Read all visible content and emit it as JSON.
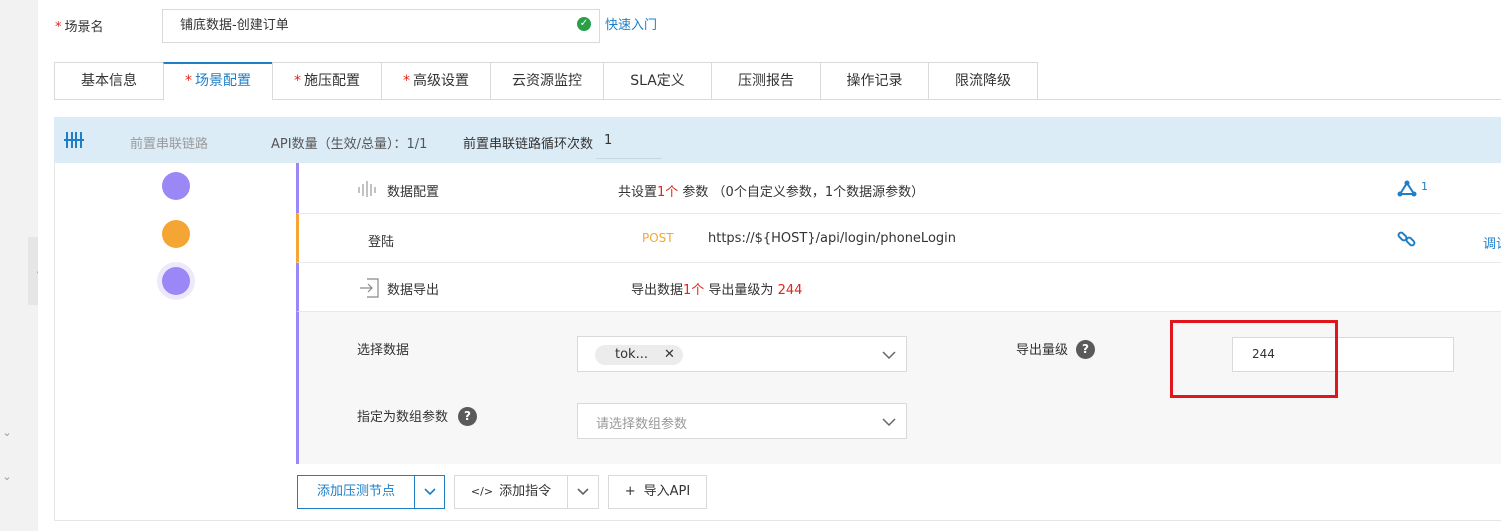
{
  "scene": {
    "label": "场景名",
    "value": "铺底数据-创建订单",
    "quick_link": "快速入门"
  },
  "tabs": [
    {
      "label": "基本信息",
      "required": false
    },
    {
      "label": "场景配置",
      "required": true,
      "active": true
    },
    {
      "label": "施压配置",
      "required": true
    },
    {
      "label": "高级设置",
      "required": true
    },
    {
      "label": "云资源监控",
      "required": false
    },
    {
      "label": "SLA定义",
      "required": false
    },
    {
      "label": "压测报告",
      "required": false
    },
    {
      "label": "操作记录",
      "required": false
    },
    {
      "label": "限流降级",
      "required": false
    }
  ],
  "required_mark": "*",
  "chain": {
    "title": "前置串联链路",
    "api_count": "API数量（生效/总量）：1/1",
    "loop_label": "前置串联链路循环次数",
    "loop_value": "1"
  },
  "nodes": {
    "data_config": {
      "name": "数据配置",
      "summary_prefix": "共设置",
      "summary_count": "1个",
      "summary_suffix": " 参数 （0个自定义参数，1个数据源参数）",
      "badge": "1"
    },
    "login": {
      "name": "登陆",
      "method": "POST",
      "url": "https://${HOST}/api/login/phoneLogin",
      "debug": "调试"
    },
    "data_export": {
      "name": "数据导出",
      "summary_prefix": "导出数据",
      "summary_count": "1个",
      "summary_mid": " 导出量级为 ",
      "summary_value": "244"
    }
  },
  "export_form": {
    "select_data_label": "选择数据",
    "select_tag": "tok...",
    "export_level_label": "导出量级",
    "export_level_value": "244",
    "array_param_label": "指定为数组参数",
    "array_param_placeholder": "请选择数组参数"
  },
  "actions": {
    "add_node": "添加压测节点",
    "add_instruction": "添加指令",
    "import_api": "导入API"
  },
  "colors": {
    "accent": "#1e7fc7",
    "purple_node": "#9b87f5",
    "orange_node": "#f5a533",
    "highlight": "#e0161c"
  }
}
